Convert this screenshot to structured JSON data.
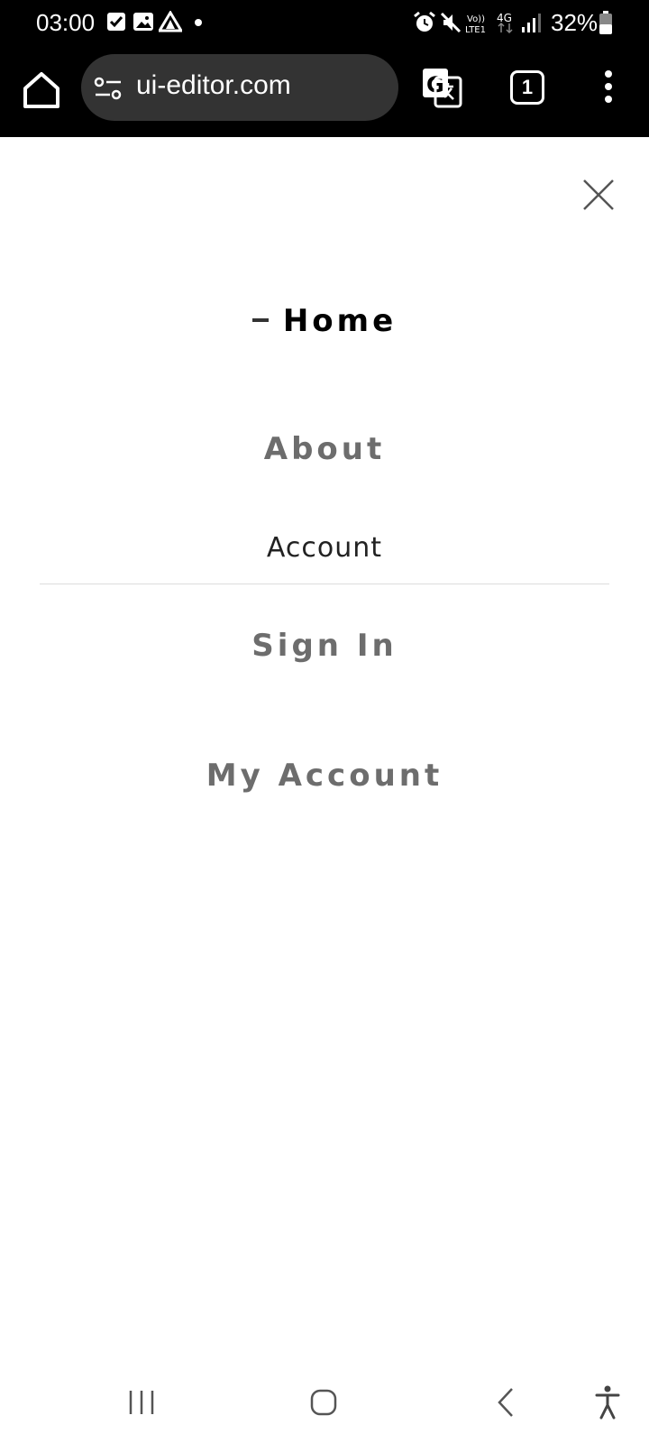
{
  "status_bar": {
    "time": "03:00",
    "battery": "32%",
    "left_icons": [
      "checkbox-icon",
      "gallery-icon",
      "arrow-app-icon",
      "dot-icon"
    ],
    "right_icons": [
      "alarm-icon",
      "mute-icon",
      "volte-icon",
      "4g-icon",
      "signal-icon",
      "battery-icon"
    ]
  },
  "browser": {
    "url": "ui-editor.com",
    "tab_count": "1"
  },
  "menu": {
    "items": [
      {
        "label": "Home",
        "active": true
      },
      {
        "label": "About"
      },
      {
        "label": "Account"
      },
      {
        "label": "Sign In"
      },
      {
        "label": "My Account"
      }
    ]
  },
  "colors": {
    "active": "#000000",
    "inactive": "#6d6d6d",
    "bar_bg": "#000000",
    "url_pill": "#333333"
  }
}
